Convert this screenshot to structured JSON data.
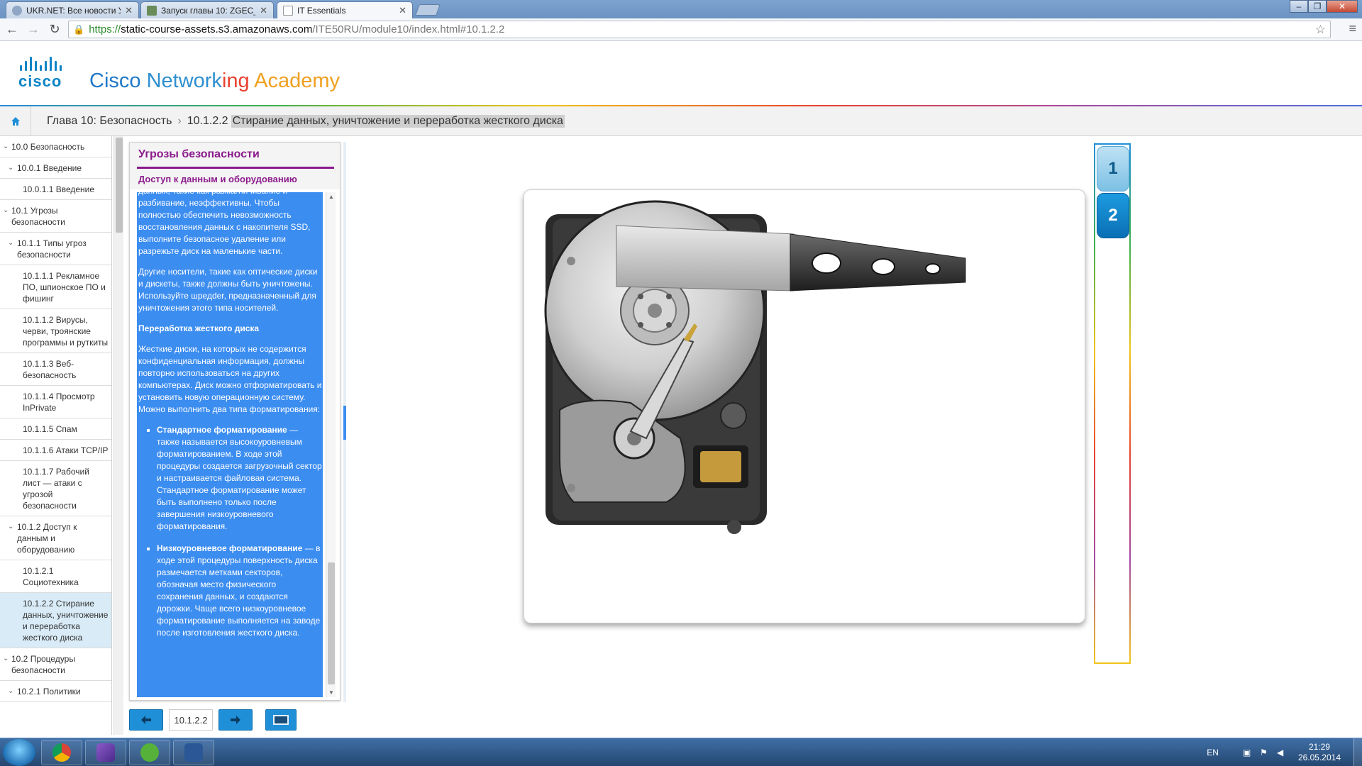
{
  "browser": {
    "tabs": [
      {
        "title": "UKR.NET: Все новости Ук",
        "active": false
      },
      {
        "title": "Запуск главы 10: ZGEC_G",
        "active": false
      },
      {
        "title": "IT Essentials",
        "active": true
      }
    ],
    "url": {
      "scheme": "https://",
      "host": "static-course-assets.s3.amazonaws.com",
      "path": "/ITE50RU/module10/index.html#10.1.2.2"
    }
  },
  "header": {
    "logo_word": "cisco",
    "academy_words": [
      {
        "text": "Cisco ",
        "color": "#1f78c8"
      },
      {
        "text": "Network",
        "color": "#2e8fd0"
      },
      {
        "text": "ing ",
        "color": "#e8422f"
      },
      {
        "text": "Academy",
        "color": "#f0a020"
      }
    ]
  },
  "breadcrumb": {
    "chapter": "Глава 10: Безопасность",
    "section_no": "10.1.2.2",
    "current": "Стирание данных, уничтожение и переработка жесткого диска"
  },
  "toc": [
    {
      "label": "10.0 Безопасность",
      "level": 0,
      "chev": true
    },
    {
      "label": "10.0.1 Введение",
      "level": 1,
      "chev": true
    },
    {
      "label": "10.0.1.1 Введение",
      "level": 2
    },
    {
      "label": "10.1 Угрозы безопасности",
      "level": 0,
      "chev": true
    },
    {
      "label": "10.1.1 Типы угроз безопасности",
      "level": 1,
      "chev": true
    },
    {
      "label": "10.1.1.1 Рекламное ПО, шпионское ПО и фишинг",
      "level": 2
    },
    {
      "label": "10.1.1.2 Вирусы, черви, троянские программы и руткиты",
      "level": 2
    },
    {
      "label": "10.1.1.3 Веб-безопасность",
      "level": 2
    },
    {
      "label": "10.1.1.4 Просмотр InPrivate",
      "level": 2
    },
    {
      "label": "10.1.1.5 Спам",
      "level": 2
    },
    {
      "label": "10.1.1.6 Атаки TCP/IP",
      "level": 2
    },
    {
      "label": "10.1.1.7 Рабочий лист — атаки с угрозой безопасности",
      "level": 2
    },
    {
      "label": "10.1.2 Доступ к данным и оборудованию",
      "level": 1,
      "chev": true
    },
    {
      "label": "10.1.2.1 Социотехника",
      "level": 2
    },
    {
      "label": "10.1.2.2 Стирание данных, уничтожение и переработка жесткого диска",
      "level": 2,
      "selected": true
    },
    {
      "label": "10.2 Процедуры безопасности",
      "level": 0,
      "chev": true
    },
    {
      "label": "10.2.1 Политики",
      "level": 1,
      "chev": true
    }
  ],
  "panel": {
    "title": "Угрозы безопасности",
    "subtitle": "Доступ к данным и оборудованию",
    "para_cut": "данных, такие как размагничивание и разбивание, неэффективны. Чтобы полностью обеспечить невозможность восстановления данных с накопителя SSD, выполните безопасное удаление или разрежьте диск на маленькие части.",
    "para_media": "Другие носители, такие как оптические диски и дискеты, также должны быть уничтожены. Используйте шредder, предназначенный для уничтожения этого типа носителей.",
    "heading_recycle": "Переработка жесткого диска",
    "para_recycle": "Жесткие диски, на которых не содержится конфиденциальная информация, должны повторно использоваться на других компьютерах. Диск можно отформатировать и установить новую операционную систему. Можно выполнить два типа форматирования:",
    "bullets": [
      {
        "bold": "Стандартное форматирование",
        "text": " — также называется высокоуровневым форматированием. В ходе этой процедуры создается загрузочный сектор и настраивается файловая система. Стандартное форматирование может быть выполнено только после завершения низкоуровневого форматирования."
      },
      {
        "bold": "Низкоуровневое форматирование",
        "text": " — в ходе этой процедуры поверхность диска размечается метками секторов, обозначая место физического сохранения данных, и создаются дорожки. Чаще всего низкоуровневое форматирование выполняется на заводе после изготовления жесткого диска."
      }
    ]
  },
  "bottom_nav": {
    "page": "10.1.2.2"
  },
  "slides": [
    "1",
    "2"
  ],
  "taskbar": {
    "lang": "EN",
    "time": "21:29",
    "date": "26.05.2014"
  },
  "colors": {
    "accent_blue": "#1f8fd8",
    "panel_purple": "#8b1a8b",
    "selection_blue": "#3c8df0"
  }
}
